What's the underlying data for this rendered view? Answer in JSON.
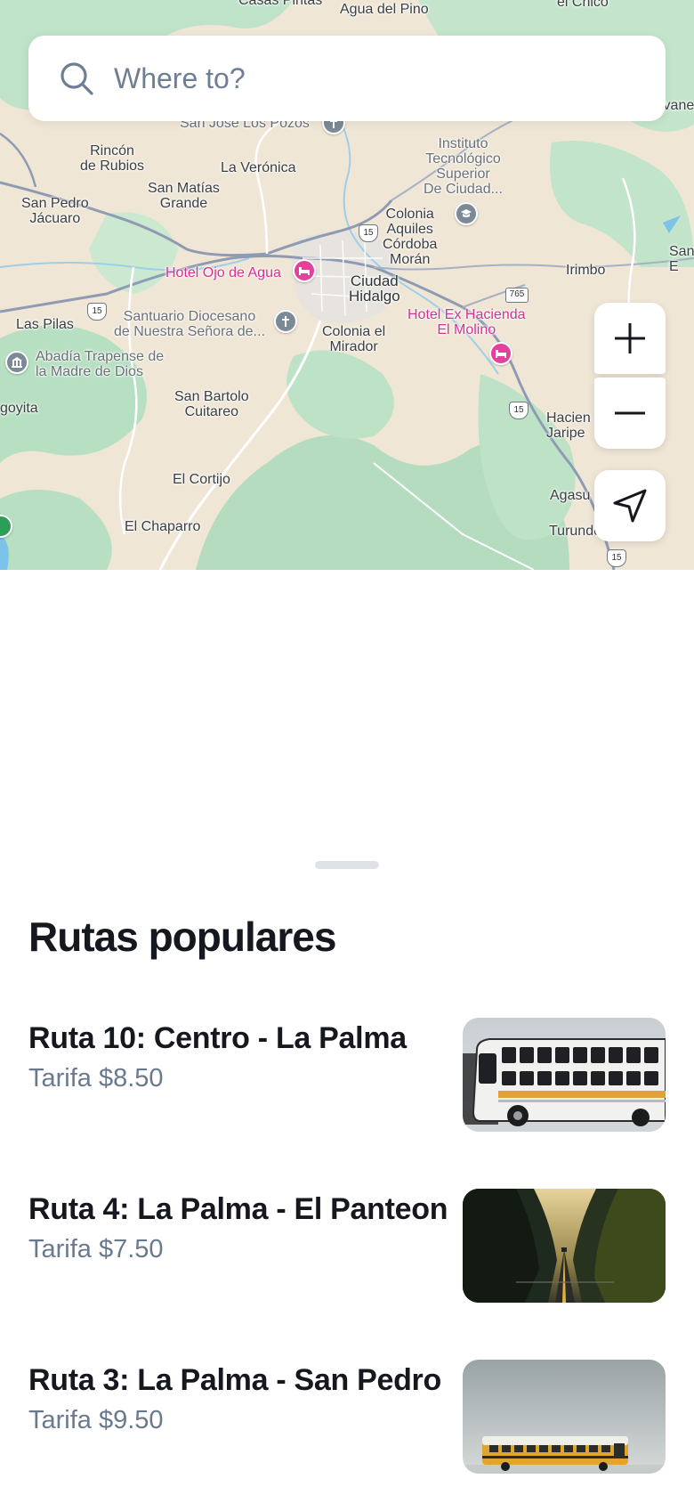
{
  "search": {
    "placeholder": "Where to?"
  },
  "map": {
    "labels": {
      "agua_del_pino": "Agua del Pino",
      "casas_pintas": "Casas Pintas",
      "el_chico": "el Chico",
      "san_jose": "San José Los Pozos",
      "rincon": "Rincón\nde Rubios",
      "la_veronica": "La Verónica",
      "san_matias": "San Matías\nGrande",
      "san_pedro_jacuaro": "San Pedro\nJácuaro",
      "instituto": "Instituto\nTecnológico\nSuperior\nDe Ciudad...",
      "colonia_aquiles": "Colonia\nAquiles\nCórdoba\nMorán",
      "ciudad_hidalgo": "Ciudad\nHidalgo",
      "hotel_ojo": "Hotel Ojo de Agua",
      "irimbo": "Irimbo",
      "las_pilas": "Las Pilas",
      "santuario": "Santuario Diocesano\nde Nuestra Señora de...",
      "colonia_mirador": "Colonia el\nMirador",
      "hotel_ex": "Hotel Ex Hacienda\nEl Molino",
      "abadia": "Abadía Trapense de\nla Madre de Dios",
      "goyita": "goyita",
      "san_bartolo": "San Bartolo\nCuitareo",
      "hacienda": "Hacien\nJaripe",
      "el_cortijo": "El Cortijo",
      "el_chaparro": "El Chaparro",
      "agasu": "Agasu",
      "turundo": "Turundo",
      "san_e": "San\nE",
      "ivane": "ivane"
    },
    "shields": {
      "h15": "15",
      "h765": "765"
    }
  },
  "controls": {
    "zoom_in_icon": "plus-icon",
    "zoom_out_icon": "minus-icon",
    "locate_icon": "navigation-arrow-icon"
  },
  "section": {
    "title": "Rutas populares"
  },
  "routes": [
    {
      "name": "Ruta 10: Centro - La Palma",
      "fare": "Tarifa $8.50",
      "thumb": "white-bus-photo"
    },
    {
      "name": "Ruta 4: La Palma - El Panteon",
      "fare": "Tarifa $7.50",
      "thumb": "canyon-road-photo"
    },
    {
      "name": "Ruta 3: La Palma - San Pedro",
      "fare": "Tarifa $9.50",
      "thumb": "yellow-bus-photo"
    }
  ],
  "colors": {
    "accent_pink": "#d8318f",
    "text_primary": "#15191f",
    "text_secondary": "#6a7a8e",
    "map_green": "#b9dfc3",
    "map_land": "#efe6d6"
  }
}
